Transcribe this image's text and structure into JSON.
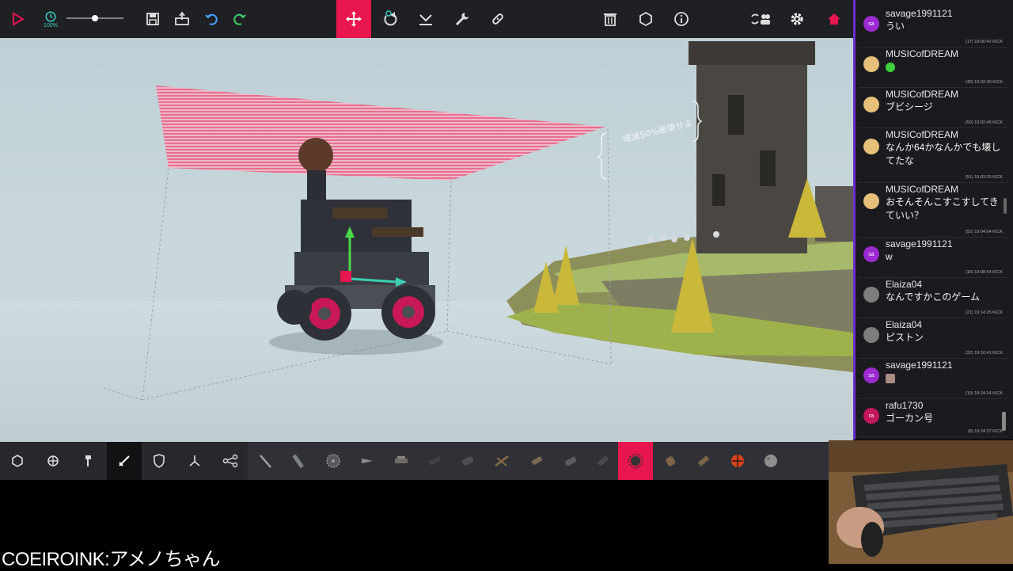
{
  "toolbar": {
    "time_scale_label": "100%",
    "slider_level": 0.5,
    "colors": {
      "accent": "#e8164f",
      "bg": "#1e2024",
      "undo": "#4aa3ff",
      "redo": "#3ecf6a"
    }
  },
  "scene": {
    "overlay_text": "壊滅50%破壊せよ"
  },
  "chat": {
    "messages": [
      {
        "user": "savage1991121",
        "avatar": "sa",
        "avatar_color": "#9b2ad1",
        "text": "うい",
        "meta": "(17)  19:00:42  KICK"
      },
      {
        "user": "MUSICofDREAM",
        "avatar": "",
        "avatar_color": "#e6c07a",
        "text": "",
        "emote": "green-emote",
        "meta": "(49)  19:02:40  KICK"
      },
      {
        "user": "MUSICofDREAM",
        "avatar": "",
        "avatar_color": "#e6c07a",
        "text": "ブビシージ",
        "meta": "(50)  19:02:46  KICK"
      },
      {
        "user": "MUSICofDREAM",
        "avatar": "",
        "avatar_color": "#e6c07a",
        "text": "なんか64かなんかでも壊してたな",
        "meta": "(51)  19:03:33  KICK"
      },
      {
        "user": "MUSICofDREAM",
        "avatar": "",
        "avatar_color": "#e6c07a",
        "text": "おそんそんこすこすしてきていい？",
        "meta": "(52)  19:04:04  KICK"
      },
      {
        "user": "savage1991121",
        "avatar": "sa",
        "avatar_color": "#9b2ad1",
        "text": "w",
        "meta": "(18)  19:08:54  KICK"
      },
      {
        "user": "Elaiza04",
        "avatar": "",
        "avatar_color": "#7d7d7d",
        "text": "なんですかこのゲーム",
        "meta": "(21)  19:14:25  KICK"
      },
      {
        "user": "Elaiza04",
        "avatar": "",
        "avatar_color": "#7d7d7d",
        "text": "ピストン",
        "meta": "(22)  19:16:41  KICK"
      },
      {
        "user": "savage1991121",
        "avatar": "sa",
        "avatar_color": "#9b2ad1",
        "text": "",
        "emote": "image-emote",
        "meta": "(19)  19:24:24  KICK"
      },
      {
        "user": "rafu1730",
        "avatar": "ra",
        "avatar_color": "#c2185b",
        "text": "ゴーカン号",
        "meta": "(8)  19:24:37  KICK"
      }
    ]
  },
  "caption": "COEIROINK:アメノちゃん"
}
